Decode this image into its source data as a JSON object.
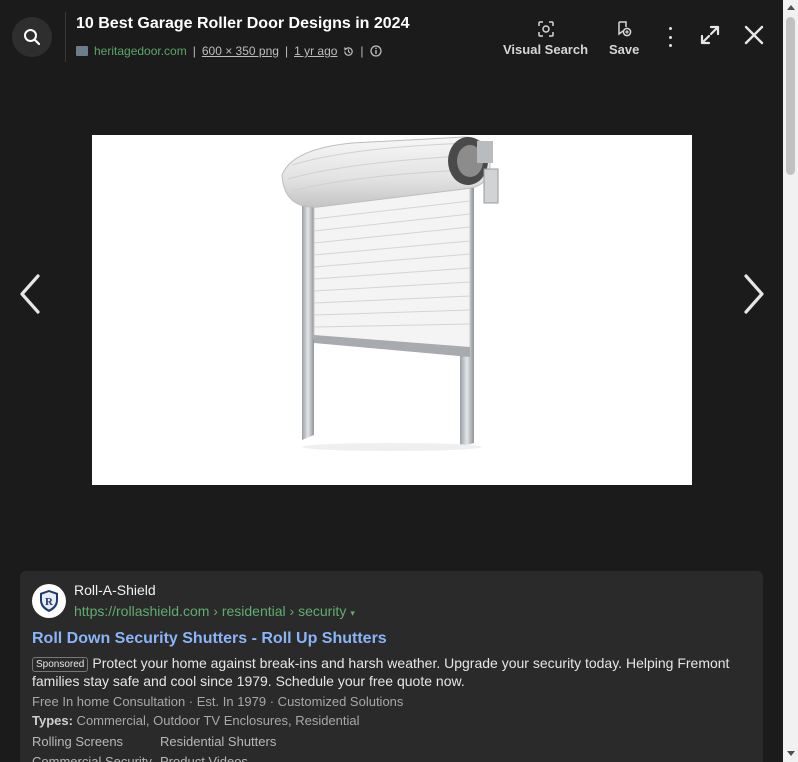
{
  "header": {
    "title": "10 Best Garage Roller Door Designs in 2024",
    "site": "heritagedoor.com",
    "dimensions": "600 × 350 png",
    "age": "1 yr ago",
    "separator": "|",
    "visual_search_label": "Visual Search",
    "save_label": "Save"
  },
  "image": {
    "alt": "White roll-up garage roller door with steel frame"
  },
  "ad": {
    "advertiser": "Roll-A-Shield",
    "logo_letter": "R",
    "url": "https://rollashield.com › residential › security",
    "caret": "▾",
    "headline": "Roll Down Security Shutters - Roll Up Shutters",
    "sponsored_label": "Sponsored",
    "description": "Protect your home against break-ins and harsh weather. Upgrade your security today. Helping Fremont families stay safe and cool since 1979. Schedule your free quote now.",
    "extensions": "Free In home Consultation · Est. In 1979 · Customized Solutions",
    "types_label": "Types:",
    "types_value": " Commercial, Outdoor TV Enclosures, Residential",
    "sitelinks": [
      "Rolling Screens",
      "Residential Shutters",
      "Commercial Security",
      "Product Videos"
    ]
  },
  "colors": {
    "background": "#1b1b1b",
    "link_green": "#58a867",
    "headline_blue": "#8ab4f8",
    "card": "#2a2a2a"
  },
  "icons": [
    "search-icon",
    "site-favicon",
    "history-icon",
    "info-icon",
    "visual-search-icon",
    "save-icon",
    "more-vert-icon",
    "expand-icon",
    "close-icon",
    "chevron-left-icon",
    "chevron-right-icon"
  ]
}
